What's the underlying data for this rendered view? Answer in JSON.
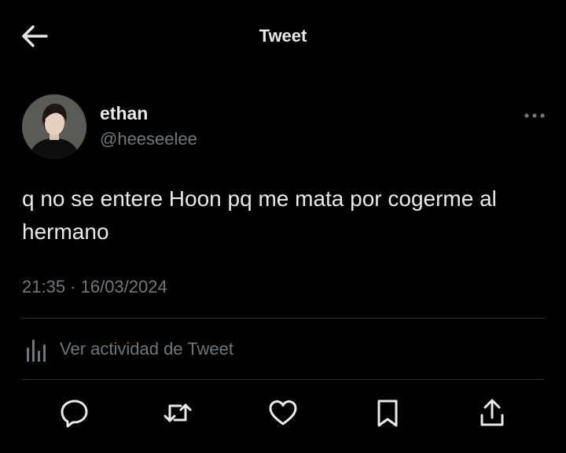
{
  "header": {
    "back_icon": "arrow-left-icon",
    "title": "Tweet"
  },
  "tweet": {
    "author": {
      "display_name": "ethan",
      "handle": "@heeseelee",
      "avatar": "profile-photo"
    },
    "more_icon": "more-horizontal-icon",
    "text": "q no se entere Hoon pq me mata por cogerme al hermano",
    "timestamp": "21:35 · 16/03/2024"
  },
  "activity": {
    "icon": "bar-chart-icon",
    "label": "Ver actividad de Tweet"
  },
  "actions": [
    {
      "name": "reply",
      "icon": "reply-icon"
    },
    {
      "name": "retweet",
      "icon": "retweet-icon"
    },
    {
      "name": "like",
      "icon": "heart-icon"
    },
    {
      "name": "bookmark",
      "icon": "bookmark-icon"
    },
    {
      "name": "share",
      "icon": "share-icon"
    }
  ],
  "colors": {
    "background": "#000000",
    "text_primary": "#e7e9ea",
    "text_secondary": "#71767b",
    "divider": "#2f3336"
  }
}
